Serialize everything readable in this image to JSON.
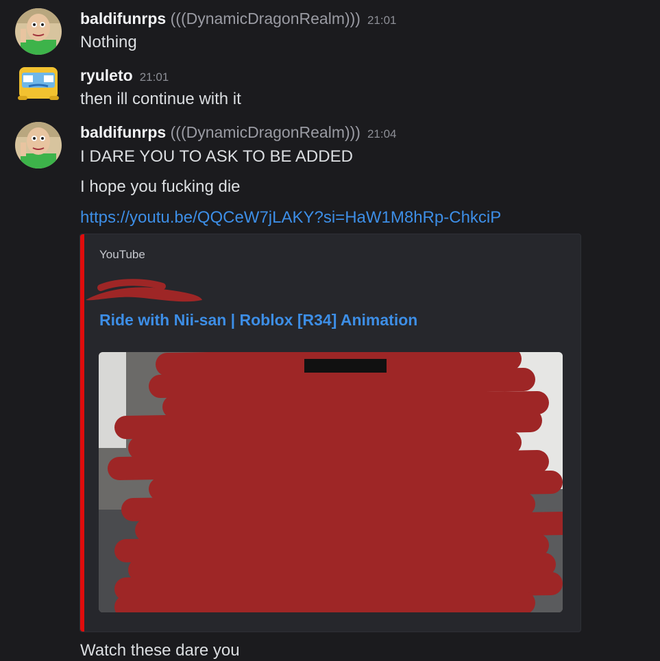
{
  "messages": [
    {
      "username": "baldifunrps",
      "nickname": "((DynamicDragonRealm))",
      "timestamp": "21:01",
      "lines": [
        "Nothing"
      ]
    },
    {
      "username": "ryuleto",
      "timestamp": "21:01",
      "lines": [
        "then ill continue with it"
      ]
    },
    {
      "username": "baldifunrps",
      "nickname": "((DynamicDragonRealm))",
      "timestamp": "21:04",
      "lines": [
        "I DARE YOU TO ASK TO BE ADDED",
        "I hope you fucking die"
      ],
      "link": "https://youtu.be/QQCeW7jLAKY?si=HaW1M8hRp-ChkciP",
      "embed": {
        "provider": "YouTube",
        "title": "Ride with Nii-san | Roblox [R34] Animation"
      },
      "after": "Watch these dare you"
    }
  ],
  "colors": {
    "background": "#1b1b1e",
    "link": "#3d8ee6",
    "embed_bar": "#e00c0c",
    "scribble": "#9e2626"
  }
}
